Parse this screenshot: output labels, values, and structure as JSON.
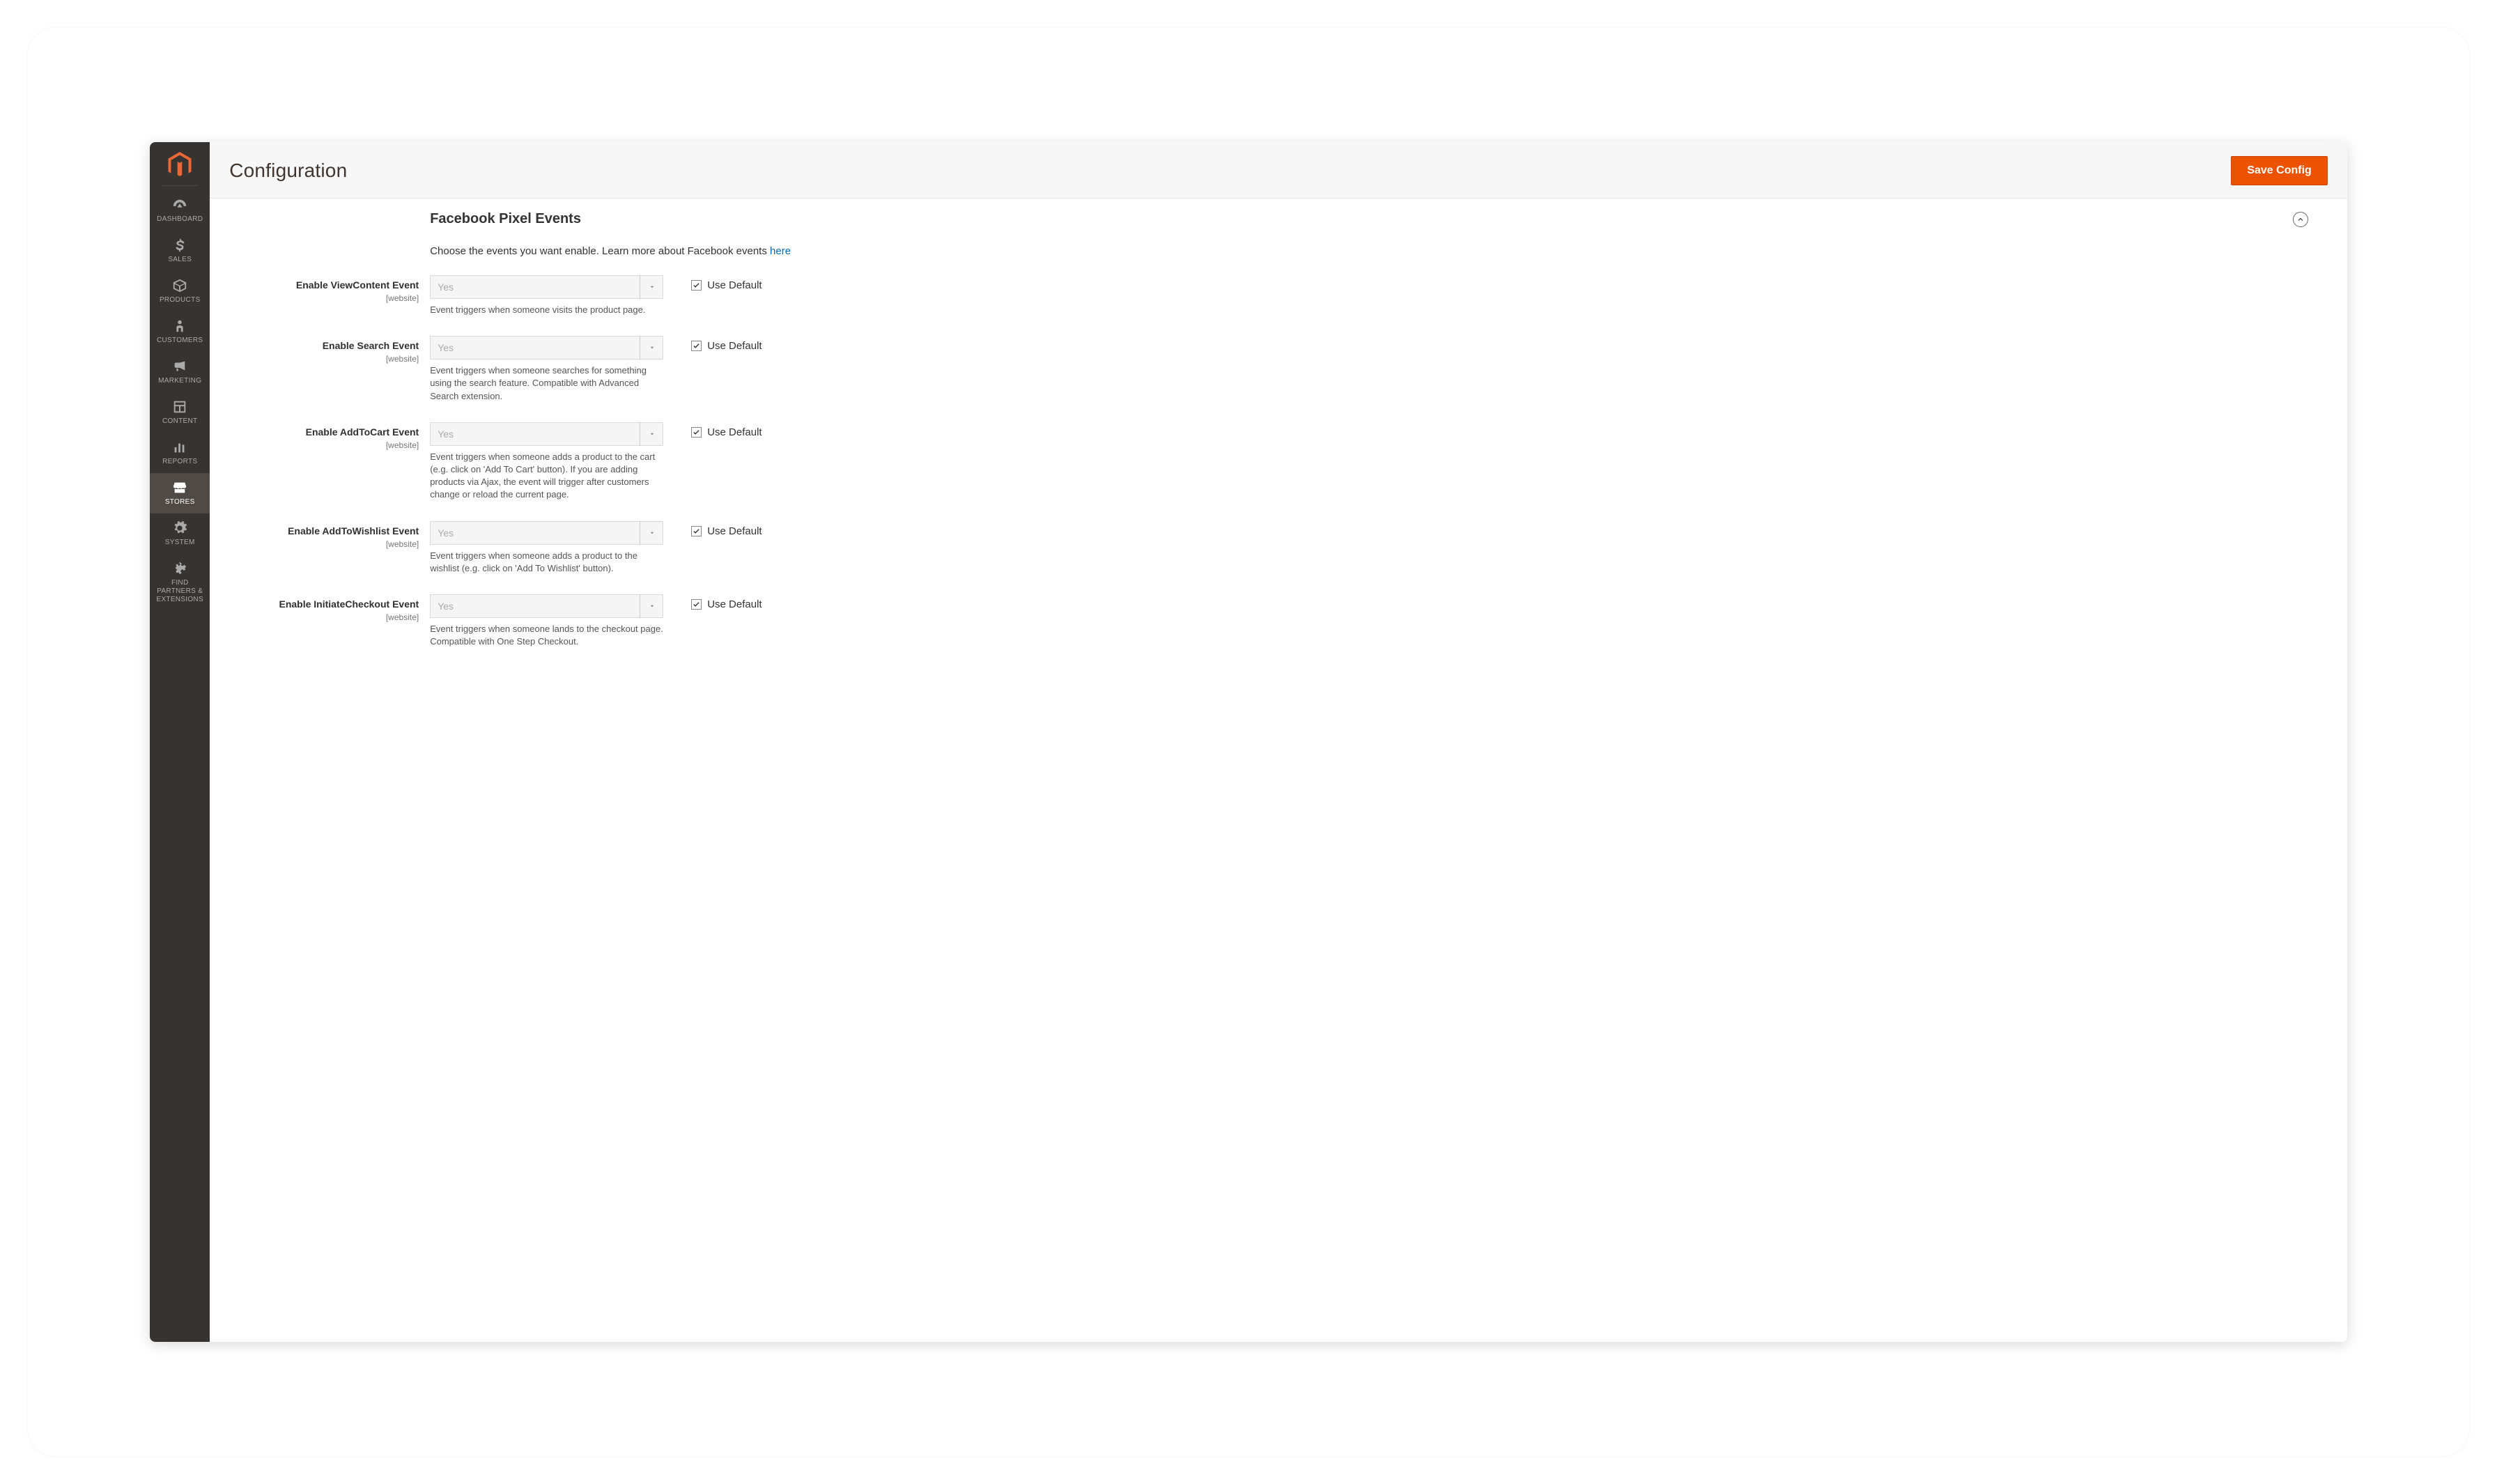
{
  "topbar": {
    "title": "Configuration",
    "save_label": "Save Config"
  },
  "sidebar": {
    "items": [
      {
        "id": "dashboard",
        "label": "DASHBOARD"
      },
      {
        "id": "sales",
        "label": "SALES"
      },
      {
        "id": "products",
        "label": "PRODUCTS"
      },
      {
        "id": "customers",
        "label": "CUSTOMERS"
      },
      {
        "id": "marketing",
        "label": "MARKETING"
      },
      {
        "id": "content",
        "label": "CONTENT"
      },
      {
        "id": "reports",
        "label": "REPORTS"
      },
      {
        "id": "stores",
        "label": "STORES"
      },
      {
        "id": "system",
        "label": "SYSTEM"
      },
      {
        "id": "partners",
        "label": "FIND PARTNERS & EXTENSIONS"
      }
    ],
    "active_id": "stores"
  },
  "section": {
    "title": "Facebook Pixel Events",
    "intro_prefix": "Choose the events you want enable. Learn more about Facebook events ",
    "intro_link": "here"
  },
  "fields": [
    {
      "label": "Enable ViewContent Event",
      "value": "Yes",
      "note": "Event triggers when someone visits the product page.",
      "default_label": "Use Default"
    },
    {
      "label": "Enable Search Event",
      "value": "Yes",
      "note": "Event triggers when someone searches for something using the search feature. Compatible with Advanced Search extension.",
      "default_label": "Use Default"
    },
    {
      "label": "Enable AddToCart Event",
      "value": "Yes",
      "note": "Event triggers when someone adds a product to the cart (e.g. click on 'Add To Cart' button). If you are adding products via Ajax, the event will trigger after customers change or reload the current page.",
      "default_label": "Use Default"
    },
    {
      "label": "Enable AddToWishlist Event",
      "value": "Yes",
      "note": "Event triggers when someone adds a product to the wishlist (e.g. click on 'Add To Wishlist' button).",
      "default_label": "Use Default"
    },
    {
      "label": "Enable InitiateCheckout Event",
      "value": "Yes",
      "note": "Event triggers when someone lands to the checkout page. Compatible with One Step Checkout.",
      "default_label": "Use Default"
    }
  ],
  "scope_label": "[website]"
}
